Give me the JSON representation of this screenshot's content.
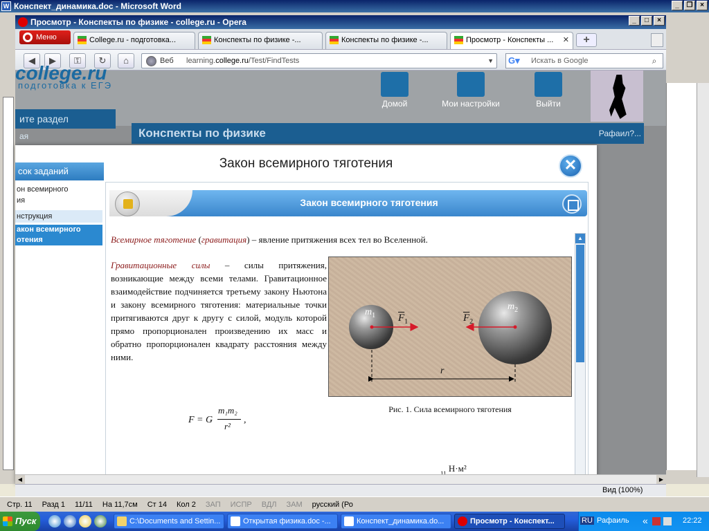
{
  "word": {
    "title": "Конспект_динамика.doc - Microsoft Word",
    "status": {
      "page": "Стр. 11",
      "section": "Разд 1",
      "pages": "11/11",
      "at": "На 11,7см",
      "line": "Ст 14",
      "col": "Кол 2",
      "rec": "ЗАП",
      "trk": "ИСПР",
      "ext": "ВДЛ",
      "ovr": "ЗАМ",
      "lang": "русский (Ро"
    }
  },
  "opera": {
    "title": "Просмотр - Конспекты по физике - college.ru - Opera",
    "menu_label": "Меню",
    "tabs": [
      {
        "label": "College.ru - подготовка..."
      },
      {
        "label": "Конспекты по физике -..."
      },
      {
        "label": "Конспекты по физике -..."
      },
      {
        "label": "Просмотр - Конспекты ..."
      }
    ],
    "address": {
      "prefix": "Веб",
      "url_pre": "learning.",
      "url_host": "college.ru",
      "url_post": "/Test/FindTests"
    },
    "search_placeholder": "Искать в Google",
    "zoom": "Вид (100%)"
  },
  "site": {
    "logo": "college.ru",
    "logo_sub": "подготовка к ЕГЭ",
    "nav": [
      {
        "label": "Домой"
      },
      {
        "label": "Мои настройки"
      },
      {
        "label": "Выйти"
      }
    ],
    "section_head": "ите раздел",
    "section_sub": "ая",
    "main_head": "Конспекты по физике",
    "user": "Рафаил?..."
  },
  "modal": {
    "title": "Закон всемирного тяготения",
    "task_head": "сок заданий",
    "tasks": [
      {
        "label": "он всемирного"
      },
      {
        "label": "ия"
      },
      {
        "label": "нструкция"
      },
      {
        "label": "акон всемирного"
      },
      {
        "label": "отения"
      }
    ],
    "content_title": "Закон всемирного тяготения",
    "defn": {
      "term1": "Всемирное тяготение",
      "open": " (",
      "term2": "гравитация",
      "rest": ") – явление притяжения всех тел во Вселенной."
    },
    "para": {
      "term": "Гравитационные силы",
      "text": " – силы притяжения, возникающие между всеми телами. Гравитационное взаимодействие подчиняется третьему закону Ньютона и закону всемирного тяготения: материальные точки притягиваются друг к другу с силой, модуль которой прямо пропорционален произведению их масс и обратно пропорционален квадрату расстояния между ними."
    },
    "figure": {
      "caption": "Рис. 1. Сила всемирного тяготения",
      "m1": "m",
      "m1_sub": "1",
      "m2": "m",
      "m2_sub": "2",
      "f1": "F",
      "f1_sub": "1",
      "f2": "F",
      "f2_sub": "2",
      "r": "r"
    },
    "formula": {
      "lhs": "F = G",
      "num": "m₁m₂",
      "den": "r²",
      "tail": ","
    },
    "units": {
      "exp": "11",
      "text": "Н·м²"
    }
  },
  "taskbar": {
    "start": "Пуск",
    "items": [
      {
        "label": "C:\\Documents and Settin..."
      },
      {
        "label": "Открытая физика.doc -..."
      },
      {
        "label": "Конспект_динамика.do..."
      },
      {
        "label": "Просмотр - Конспект..."
      }
    ],
    "lang": "RU",
    "user": "Рафаиль",
    "clock": "22:22"
  }
}
